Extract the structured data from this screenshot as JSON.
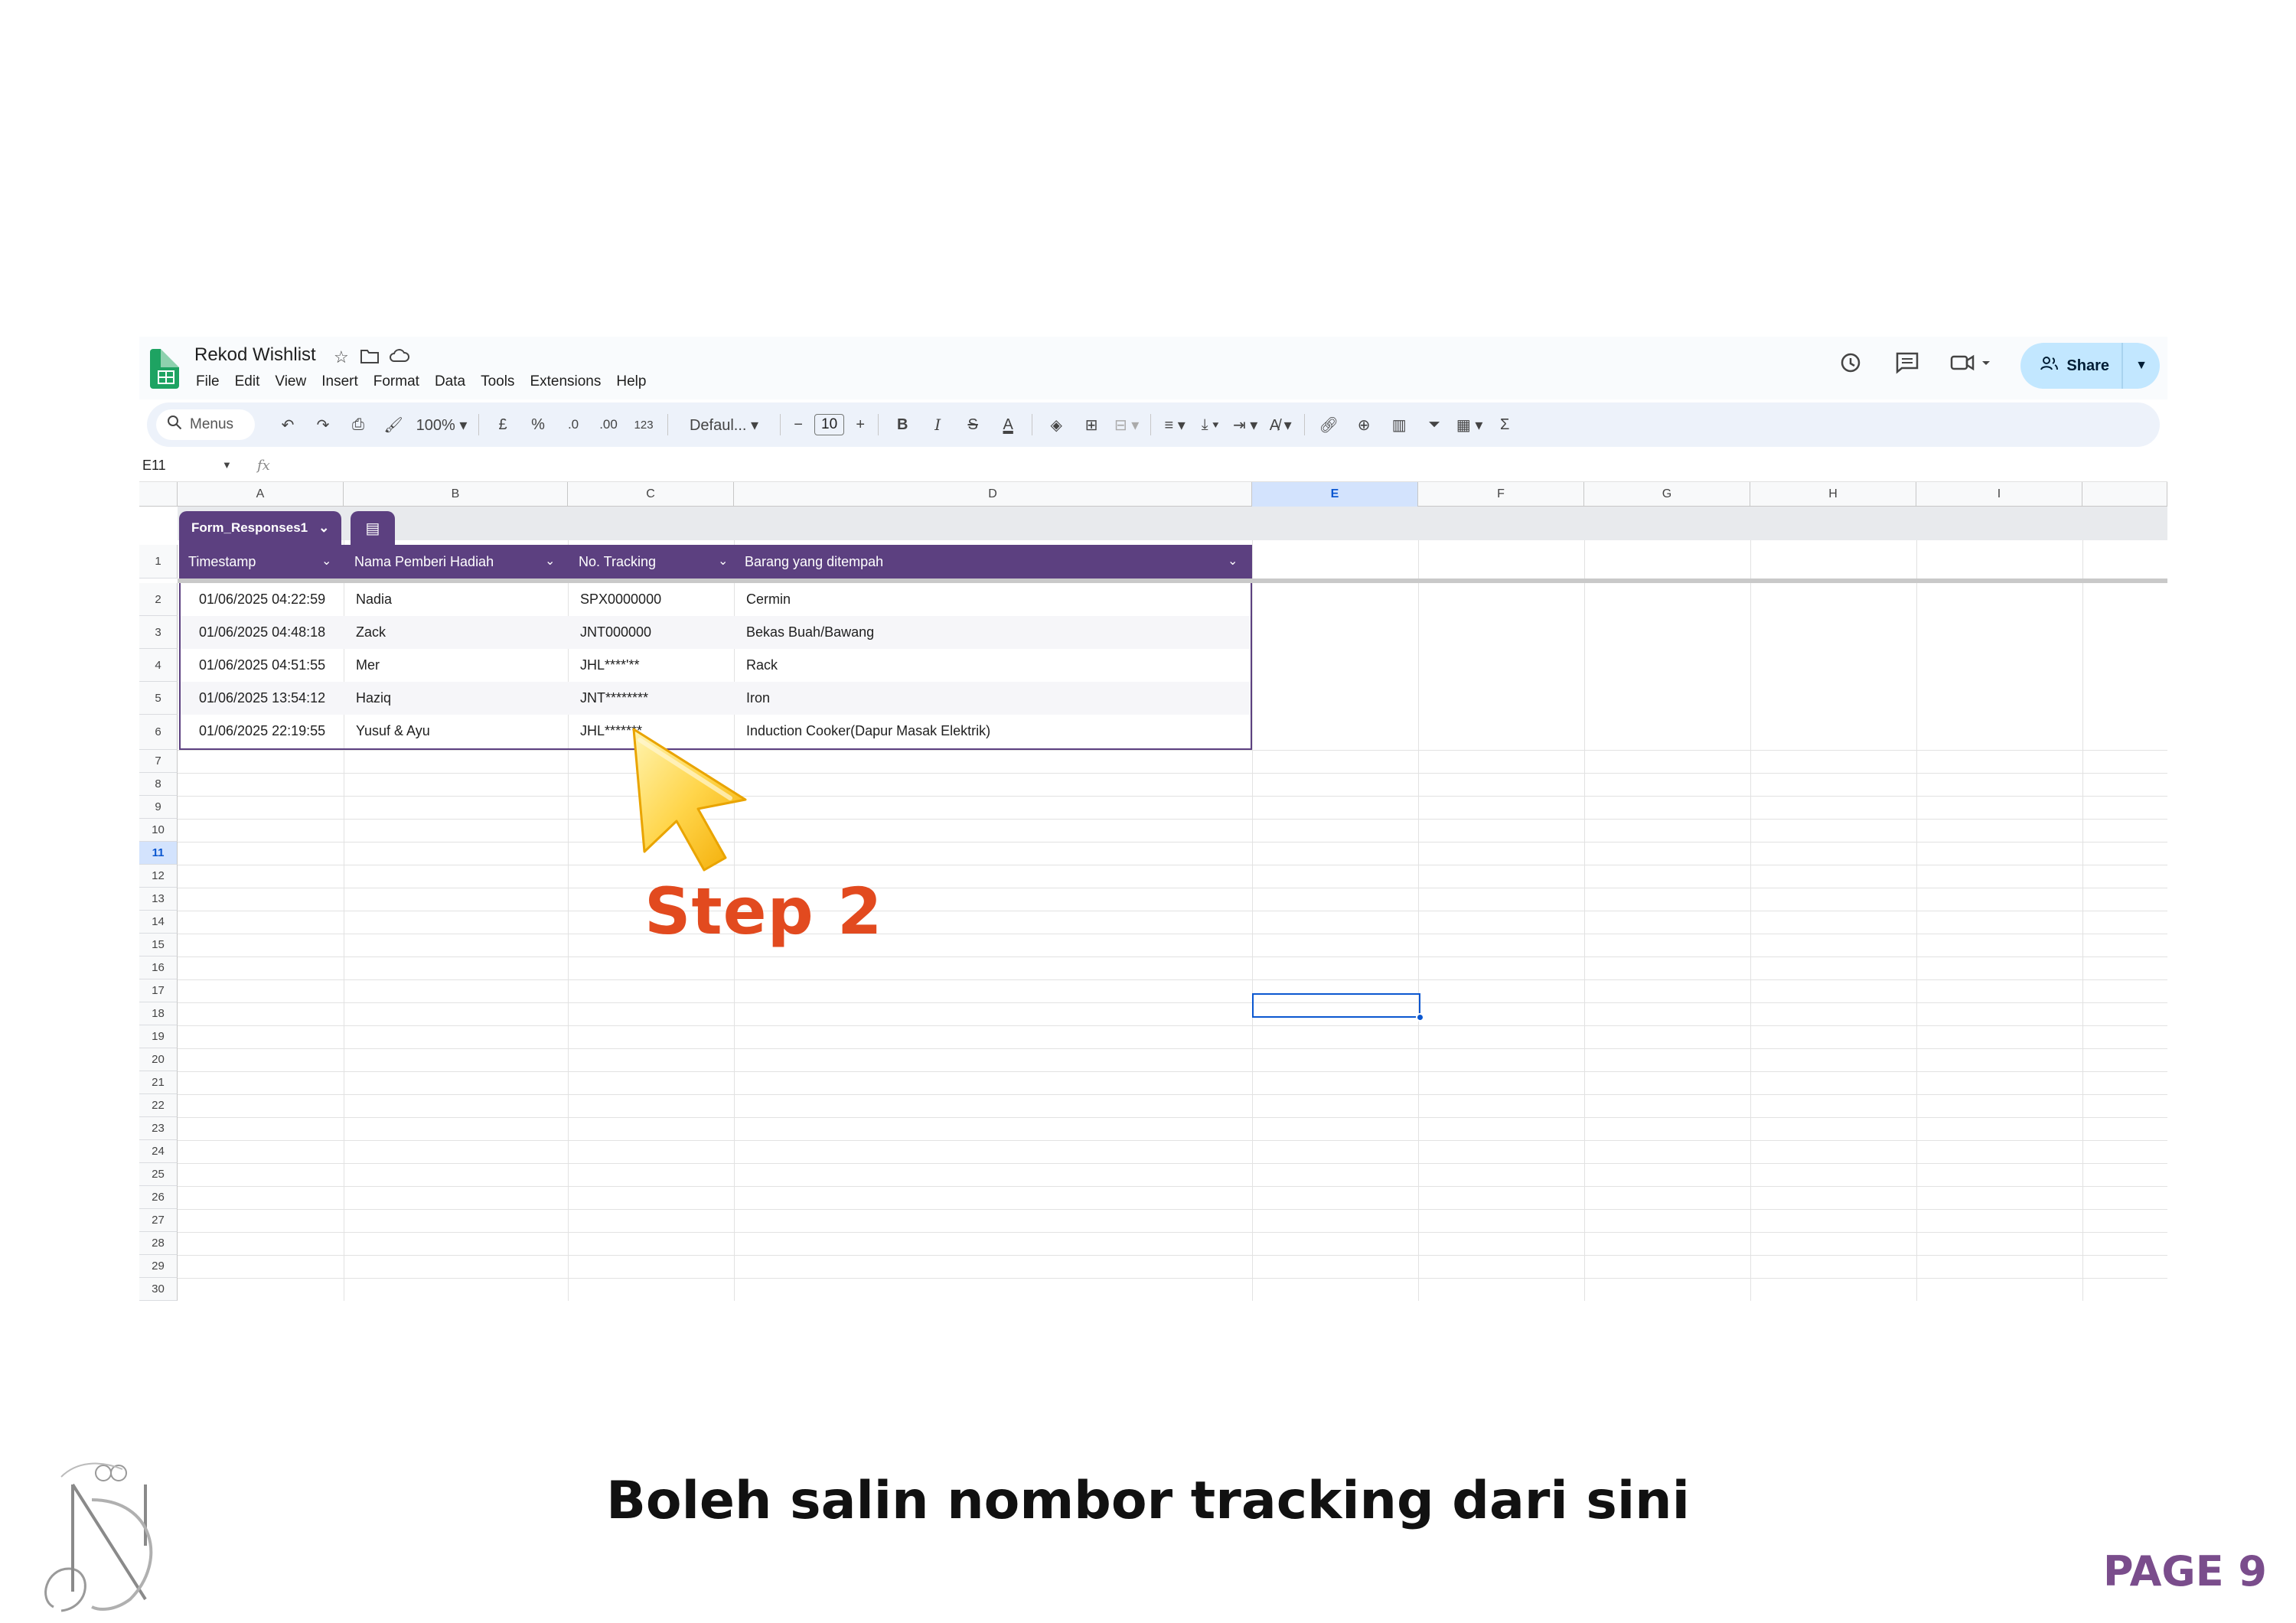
{
  "app": {
    "doc_title": "Rekod Wishlist",
    "menus": [
      "File",
      "Edit",
      "View",
      "Insert",
      "Format",
      "Data",
      "Tools",
      "Extensions",
      "Help"
    ],
    "share_label": "Share"
  },
  "toolbar": {
    "search_label": "Menus",
    "zoom": "100%",
    "currency": "£",
    "percent": "%",
    "dec_decrease": ".0",
    "dec_increase": ".00",
    "number_format": "123",
    "font": "Defaul...",
    "font_size": "10",
    "bold": "B",
    "italic": "I",
    "strike": "S",
    "text_color": "A",
    "sum": "Σ"
  },
  "formula_bar": {
    "name_box": "E11",
    "fx": "fx"
  },
  "columns": [
    "A",
    "B",
    "C",
    "D",
    "E",
    "F",
    "G",
    "H",
    "I"
  ],
  "selected_column": "E",
  "rows": [
    "1",
    "2",
    "3",
    "4",
    "5",
    "6",
    "7",
    "8",
    "9",
    "10",
    "11",
    "12",
    "13",
    "14",
    "15",
    "16",
    "17",
    "18",
    "19",
    "20",
    "21",
    "22",
    "23",
    "24",
    "25",
    "26",
    "27",
    "28",
    "29",
    "30"
  ],
  "selected_row": "11",
  "table": {
    "name": "Form_Responses1",
    "headers": [
      "Timestamp",
      "Nama Pemberi Hadiah",
      "No. Tracking",
      "Barang yang ditempah"
    ],
    "rows": [
      [
        "01/06/2025 04:22:59",
        "Nadia",
        "SPX0000000",
        "Cermin"
      ],
      [
        "01/06/2025 04:48:18",
        "Zack",
        "JNT000000",
        "Bekas Buah/Bawang"
      ],
      [
        "01/06/2025 04:51:55",
        "Mer",
        "JHL****'**",
        "Rack"
      ],
      [
        "01/06/2025 13:54:12",
        "Haziq",
        "JNT********",
        "Iron"
      ],
      [
        "01/06/2025 22:19:55",
        "Yusuf & Ayu",
        "JHL*******",
        "Induction Cooker(Dapur Masak Elektrik)"
      ]
    ]
  },
  "annotation": {
    "step": "Step 2"
  },
  "caption": "Boleh salin nombor tracking dari sini",
  "page_label": "PAGE 9",
  "colors": {
    "table_header": "#5c4080",
    "step_text": "#e24a1f",
    "page_label": "#7a4d8c",
    "share_bg": "#c2e7ff"
  }
}
